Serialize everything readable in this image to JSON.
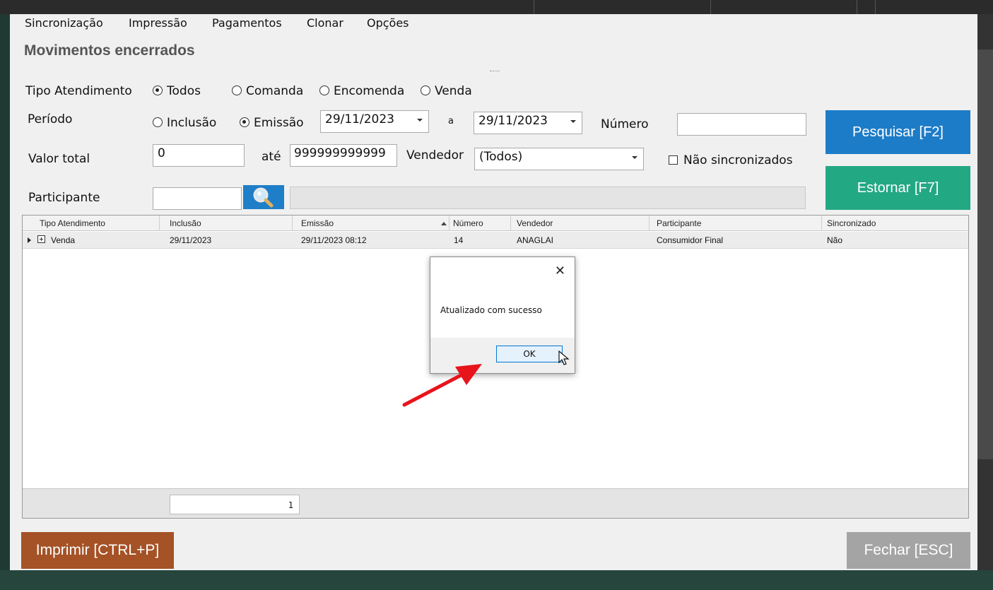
{
  "menu": [
    "Sincronização",
    "Impressão",
    "Pagamentos",
    "Clonar",
    "Opções"
  ],
  "title": "Movimentos encerrados",
  "tipo_atendimento": {
    "label": "Tipo Atendimento",
    "options": [
      {
        "label": "Todos",
        "selected": true
      },
      {
        "label": "Comanda",
        "selected": false
      },
      {
        "label": "Encomenda",
        "selected": false
      },
      {
        "label": "Venda",
        "selected": false
      }
    ]
  },
  "periodo": {
    "label": "Período",
    "options": [
      {
        "label": "Inclusão",
        "selected": false
      },
      {
        "label": "Emissão",
        "selected": true
      }
    ],
    "date_from": "29/11/2023",
    "to_label": "a",
    "date_to": "29/11/2023"
  },
  "numero": {
    "label": "Número",
    "value": ""
  },
  "valor_total": {
    "label": "Valor total",
    "from": "0",
    "until_label": "até",
    "to": "999999999999"
  },
  "vendedor": {
    "label": "Vendedor",
    "value": "(Todos)"
  },
  "nao_sincronizados": {
    "label": "Não sincronizados",
    "checked": false
  },
  "participante": {
    "label": "Participante",
    "code": "",
    "description": ""
  },
  "buttons": {
    "pesquisar": "Pesquisar [F2]",
    "estornar": "Estornar [F7]",
    "imprimir": "Imprimir [CTRL+P]",
    "fechar": "Fechar [ESC]"
  },
  "grid": {
    "columns": [
      "Tipo Atendimento",
      "Inclusão",
      "Emissão",
      "Número",
      "Vendedor",
      "Participante",
      "Sincronizado"
    ],
    "sorted_column": "Emissão",
    "rows": [
      [
        "Venda",
        "29/11/2023",
        "29/11/2023 08:12",
        "14",
        "ANAGLAI",
        "Consumidor Final",
        "Não"
      ]
    ],
    "footer_count": "1"
  },
  "dialog": {
    "message": "Atualizado com sucesso",
    "ok_label": "OK",
    "close_icon": "close-icon"
  },
  "annotation": {
    "color": "#e8141c"
  },
  "colors": {
    "pesquisar": "#1d7cc7",
    "estornar": "#23a884",
    "imprimir": "#a45226",
    "fechar": "#a4a4a4"
  }
}
